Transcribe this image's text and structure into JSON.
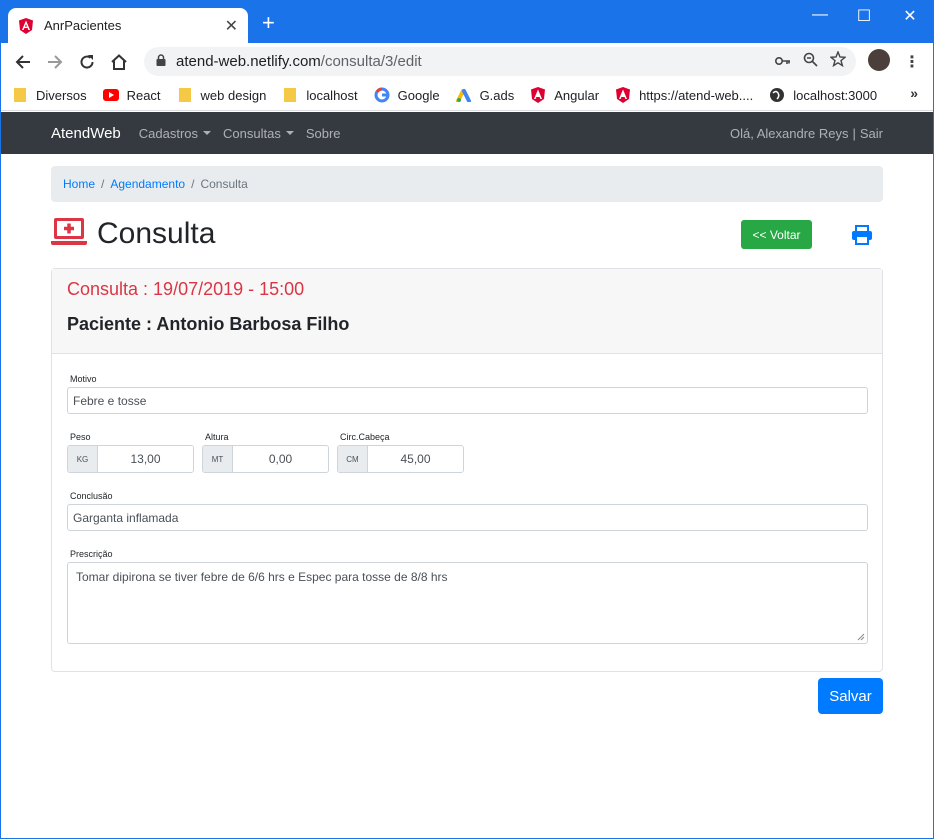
{
  "browser": {
    "tab_title": "AnrPacientes",
    "tab_close": "✕",
    "new_tab": "+",
    "window_controls": {
      "minimize": "—",
      "maximize": "☐",
      "close": "✕"
    },
    "url_host": "atend-web.netlify.com",
    "url_path": "/consulta/3/edit",
    "accent_color": "#1a73e8",
    "bookmarks": [
      {
        "label": "Diversos",
        "icon": "folder-icon"
      },
      {
        "label": "React",
        "icon": "youtube-icon"
      },
      {
        "label": "web design",
        "icon": "folder-icon"
      },
      {
        "label": "localhost",
        "icon": "folder-icon"
      },
      {
        "label": "Google",
        "icon": "google-icon"
      },
      {
        "label": "G.ads",
        "icon": "google-ads-icon"
      },
      {
        "label": "Angular",
        "icon": "angular-icon"
      },
      {
        "label": "https://atend-web....",
        "icon": "angular-icon"
      },
      {
        "label": "localhost:3000",
        "icon": "globe-icon"
      }
    ],
    "bookmarks_more": "»"
  },
  "navbar": {
    "brand": "AtendWeb",
    "items": [
      {
        "label": "Cadastros",
        "dropdown": true
      },
      {
        "label": "Consultas",
        "dropdown": true
      },
      {
        "label": "Sobre",
        "dropdown": false
      }
    ],
    "greeting": "Olá, Alexandre Reys",
    "separator": "|",
    "logout": "Sair"
  },
  "breadcrumb": {
    "items": [
      "Home",
      "Agendamento"
    ],
    "separator": "/",
    "active": "Consulta"
  },
  "page": {
    "title": "Consulta",
    "back_button": "<< Voltar",
    "save_button": "Salvar"
  },
  "consulta": {
    "header_date": "Consulta : 19/07/2019 - 15:00",
    "header_patient": "Paciente : Antonio Barbosa Filho",
    "motivo": {
      "label": "Motivo",
      "value": "Febre e tosse"
    },
    "peso": {
      "label": "Peso",
      "unit": "KG",
      "value": "13,00"
    },
    "altura": {
      "label": "Altura",
      "unit": "MT",
      "value": "0,00"
    },
    "circ": {
      "label": "Circ.Cabeça",
      "unit": "CM",
      "value": "45,00"
    },
    "conclusao": {
      "label": "Conclusão",
      "value": "Garganta inflamada"
    },
    "prescricao": {
      "label": "Prescrição",
      "value": "Tomar dipirona se tiver febre de 6/6 hrs e Espec para tosse de 8/8 hrs"
    }
  },
  "colors": {
    "navbar": "#343a40",
    "danger": "#dc3545",
    "success": "#28a745",
    "primary": "#007bff"
  }
}
